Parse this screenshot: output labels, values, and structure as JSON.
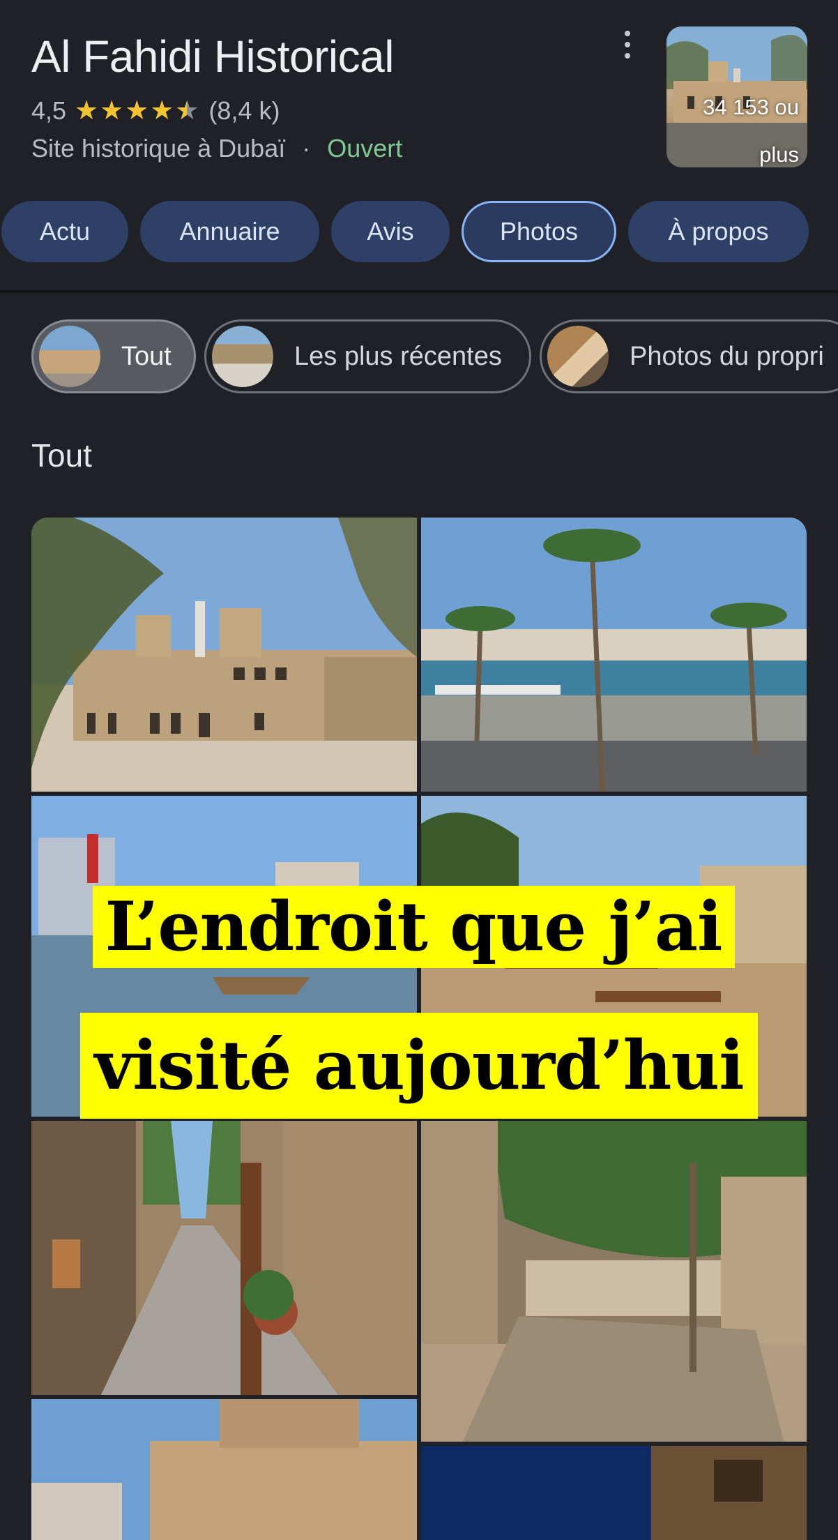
{
  "place": {
    "title": "Al Fahidi Historical",
    "rating": "4,5",
    "stars": 4.5,
    "review_count": "(8,4 k)",
    "category": "Site historique à Dubaï",
    "separator": "·",
    "status": "Ouvert",
    "status_color": "#81c995",
    "photo_count_line1": "34 153 ou",
    "photo_count_line2": "plus"
  },
  "tabs": [
    {
      "label": "Actu"
    },
    {
      "label": "Annuaire"
    },
    {
      "label": "Avis"
    },
    {
      "label": "Photos",
      "active": true
    },
    {
      "label": "À propos"
    }
  ],
  "filter_chips": [
    {
      "label": "Tout",
      "selected": true
    },
    {
      "label": "Les plus récentes"
    },
    {
      "label": "Photos du propri"
    }
  ],
  "section_title": "Tout",
  "overlay_caption": {
    "line1": "L’endroit que j’ai",
    "line2": "visité aujourd’hui"
  },
  "colors": {
    "background": "#1f2126",
    "tab_bg": "#2f4067",
    "active_tab_border": "#8ab4f8",
    "star": "#f4c430",
    "caption_bg": "#ffff00"
  },
  "icons": {
    "more": "more-vert-icon",
    "star": "star-icon"
  }
}
